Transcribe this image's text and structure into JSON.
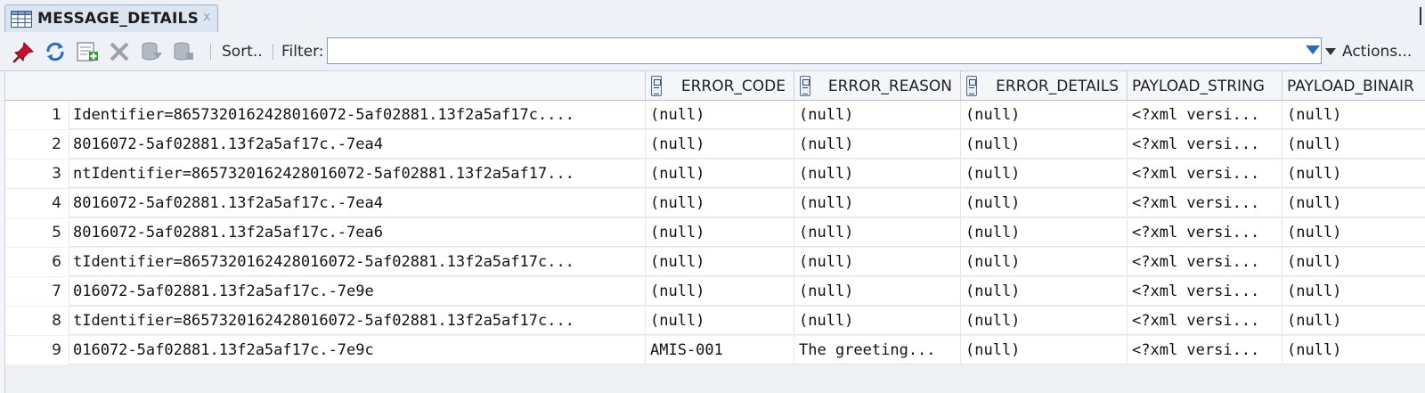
{
  "tab": {
    "title": "MESSAGE_DETAILS",
    "close": "x"
  },
  "toolbar": {
    "sort_label": "Sort..",
    "filter_label": "Filter:",
    "filter_value": "",
    "actions_label": "Actions..."
  },
  "columns": {
    "error_code": "ERROR_CODE",
    "error_reason": "ERROR_REASON",
    "error_details": "ERROR_DETAILS",
    "payload_string": "PAYLOAD_STRING",
    "payload_binair": "PAYLOAD_BINAIR"
  },
  "rows": [
    {
      "num": "1",
      "ident": "Identifier=8657320162428016072-5af02881.13f2a5af17c....",
      "error_code": "(null)",
      "error_reason": "(null)",
      "error_details": "(null)",
      "payload_string": "<?xml versi...",
      "payload_binair": "(null)"
    },
    {
      "num": "2",
      "ident": "8016072-5af02881.13f2a5af17c.-7ea4",
      "error_code": "(null)",
      "error_reason": "(null)",
      "error_details": "(null)",
      "payload_string": "<?xml versi...",
      "payload_binair": "(null)"
    },
    {
      "num": "3",
      "ident": "ntIdentifier=8657320162428016072-5af02881.13f2a5af17...",
      "error_code": "(null)",
      "error_reason": "(null)",
      "error_details": "(null)",
      "payload_string": "<?xml versi...",
      "payload_binair": "(null)"
    },
    {
      "num": "4",
      "ident": "8016072-5af02881.13f2a5af17c.-7ea4",
      "error_code": "(null)",
      "error_reason": "(null)",
      "error_details": "(null)",
      "payload_string": "<?xml versi...",
      "payload_binair": "(null)"
    },
    {
      "num": "5",
      "ident": "8016072-5af02881.13f2a5af17c.-7ea6",
      "error_code": "(null)",
      "error_reason": "(null)",
      "error_details": "(null)",
      "payload_string": "<?xml versi...",
      "payload_binair": "(null)"
    },
    {
      "num": "6",
      "ident": "tIdentifier=8657320162428016072-5af02881.13f2a5af17c...",
      "error_code": "(null)",
      "error_reason": "(null)",
      "error_details": "(null)",
      "payload_string": "<?xml versi...",
      "payload_binair": "(null)"
    },
    {
      "num": "7",
      "ident": "016072-5af02881.13f2a5af17c.-7e9e",
      "error_code": "(null)",
      "error_reason": "(null)",
      "error_details": "(null)",
      "payload_string": "<?xml versi...",
      "payload_binair": "(null)"
    },
    {
      "num": "8",
      "ident": "tIdentifier=8657320162428016072-5af02881.13f2a5af17c...",
      "error_code": "(null)",
      "error_reason": "(null)",
      "error_details": "(null)",
      "payload_string": "<?xml versi...",
      "payload_binair": "(null)"
    },
    {
      "num": "9",
      "ident": "016072-5af02881.13f2a5af17c.-7e9c",
      "error_code": "AMIS-001",
      "error_reason": "The greeting...",
      "error_details": "(null)",
      "payload_string": "<?xml versi...",
      "payload_binair": "(null)"
    }
  ],
  "icons": [
    "grid-table-icon",
    "pin-icon",
    "refresh-icon",
    "insert-row-icon",
    "delete-row-icon",
    "commit-icon",
    "rollback-icon",
    "dropdown-arrow-icon",
    "sort-column-icon"
  ],
  "colors": {
    "accent": "#2c6bc4",
    "pin": "#c8102e",
    "insert": "#3c9a2e"
  }
}
